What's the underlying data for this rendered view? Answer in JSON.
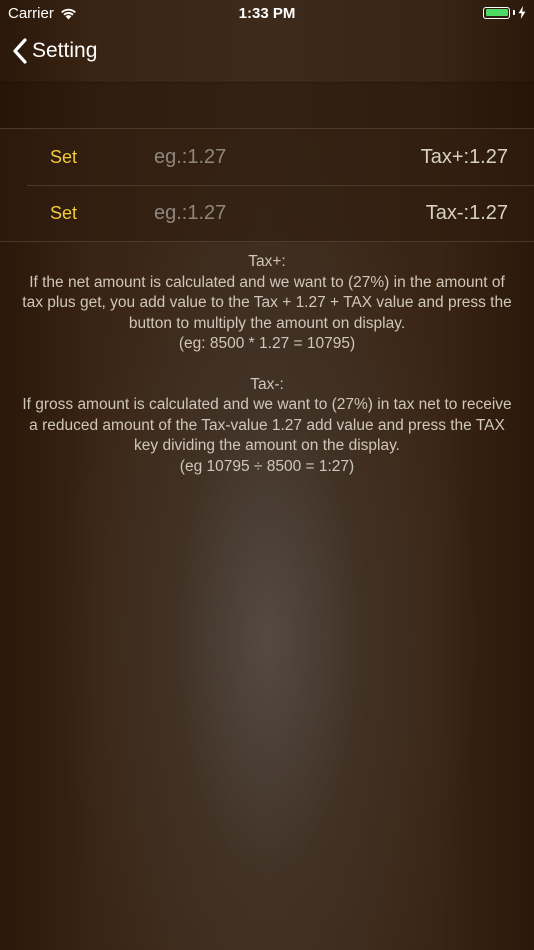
{
  "status_bar": {
    "carrier": "Carrier",
    "time": "1:33 PM",
    "battery_color": "#4cd964"
  },
  "nav": {
    "back_label": "Setting",
    "back_icon": "chevron-left-icon"
  },
  "rows": [
    {
      "button_label": "Set",
      "input_placeholder": "eg.:1.27",
      "value": "Tax+:1.27"
    },
    {
      "button_label": "Set",
      "input_placeholder": "eg.:1.27",
      "value": "Tax-:1.27"
    }
  ],
  "info": {
    "tax_plus_title": "Tax+:",
    "tax_plus_body": "If the net amount is calculated and we want to (27%) in the amount of tax plus get, you add value to the Tax + 1.27 + TAX value and press the button to multiply the amount on display.",
    "tax_plus_example": "(eg: 8500 * 1.27 = 10795)",
    "tax_minus_title": "Tax-:",
    "tax_minus_body": "If gross amount is calculated and we want to (27%) in tax net to receive a reduced amount of the Tax-value 1.27 add value and press the TAX key dividing the amount on the display.",
    "tax_minus_example": "(eg 10795 ÷ 8500 = 1:27)"
  },
  "colors": {
    "accent": "#f3cb3a",
    "text": "#d8d0c4",
    "placeholder": "#8f877d"
  }
}
